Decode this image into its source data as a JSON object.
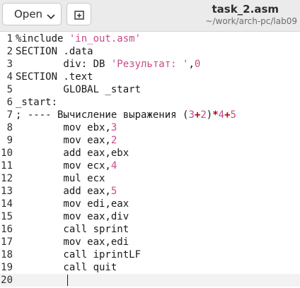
{
  "header": {
    "open_label": "Open",
    "title": "task_2.asm",
    "path": "~/work/arch-pc/lab09"
  },
  "icons": {
    "open_dropdown": "chevron-down-icon",
    "new_tab": "new-tab-icon"
  },
  "colors": {
    "string": "#c74a8a",
    "number": "#c74a8a",
    "operator": "#a30d0d"
  },
  "editor": {
    "lines": [
      {
        "num": "1",
        "segments": [
          {
            "t": "%include "
          },
          {
            "t": "'in_out.asm'",
            "c": "str"
          }
        ]
      },
      {
        "num": "2",
        "segments": [
          {
            "t": "SECTION .data"
          }
        ]
      },
      {
        "num": "3",
        "segments": [
          {
            "t": "        div: DB "
          },
          {
            "t": "'Результат: '",
            "c": "str"
          },
          {
            "t": ","
          },
          {
            "t": "0",
            "c": "num"
          }
        ]
      },
      {
        "num": "4",
        "segments": [
          {
            "t": "SECTION .text"
          }
        ]
      },
      {
        "num": "5",
        "segments": [
          {
            "t": "        GLOBAL _start"
          }
        ]
      },
      {
        "num": "6",
        "segments": [
          {
            "t": "_start:"
          }
        ]
      },
      {
        "num": "7",
        "segments": [
          {
            "t": "; ---- Вычисление выражения ("
          },
          {
            "t": "3",
            "c": "num"
          },
          {
            "t": "+",
            "c": "op"
          },
          {
            "t": "2",
            "c": "num"
          },
          {
            "t": ")"
          },
          {
            "t": "*",
            "c": "op"
          },
          {
            "t": "4",
            "c": "num"
          },
          {
            "t": "+",
            "c": "op"
          },
          {
            "t": "5",
            "c": "num"
          }
        ]
      },
      {
        "num": "8",
        "segments": [
          {
            "t": "        mov ebx,"
          },
          {
            "t": "3",
            "c": "num"
          }
        ]
      },
      {
        "num": "9",
        "segments": [
          {
            "t": "        mov eax,"
          },
          {
            "t": "2",
            "c": "num"
          }
        ]
      },
      {
        "num": "10",
        "segments": [
          {
            "t": "        add eax,ebx"
          }
        ]
      },
      {
        "num": "11",
        "segments": [
          {
            "t": "        mov ecx,"
          },
          {
            "t": "4",
            "c": "num"
          }
        ]
      },
      {
        "num": "12",
        "segments": [
          {
            "t": "        mul ecx"
          }
        ]
      },
      {
        "num": "13",
        "segments": [
          {
            "t": "        add eax,"
          },
          {
            "t": "5",
            "c": "num"
          }
        ]
      },
      {
        "num": "14",
        "segments": [
          {
            "t": "        mov edi,eax"
          }
        ]
      },
      {
        "num": "15",
        "segments": [
          {
            "t": "        mov eax,div"
          }
        ]
      },
      {
        "num": "16",
        "segments": [
          {
            "t": "        call sprint"
          }
        ]
      },
      {
        "num": "17",
        "segments": [
          {
            "t": "        mov eax,edi"
          }
        ]
      },
      {
        "num": "18",
        "segments": [
          {
            "t": "        call iprintLF"
          }
        ]
      },
      {
        "num": "19",
        "segments": [
          {
            "t": "        call quit"
          }
        ]
      },
      {
        "num": "20",
        "segments": [
          {
            "t": ""
          }
        ],
        "current": true
      }
    ]
  }
}
